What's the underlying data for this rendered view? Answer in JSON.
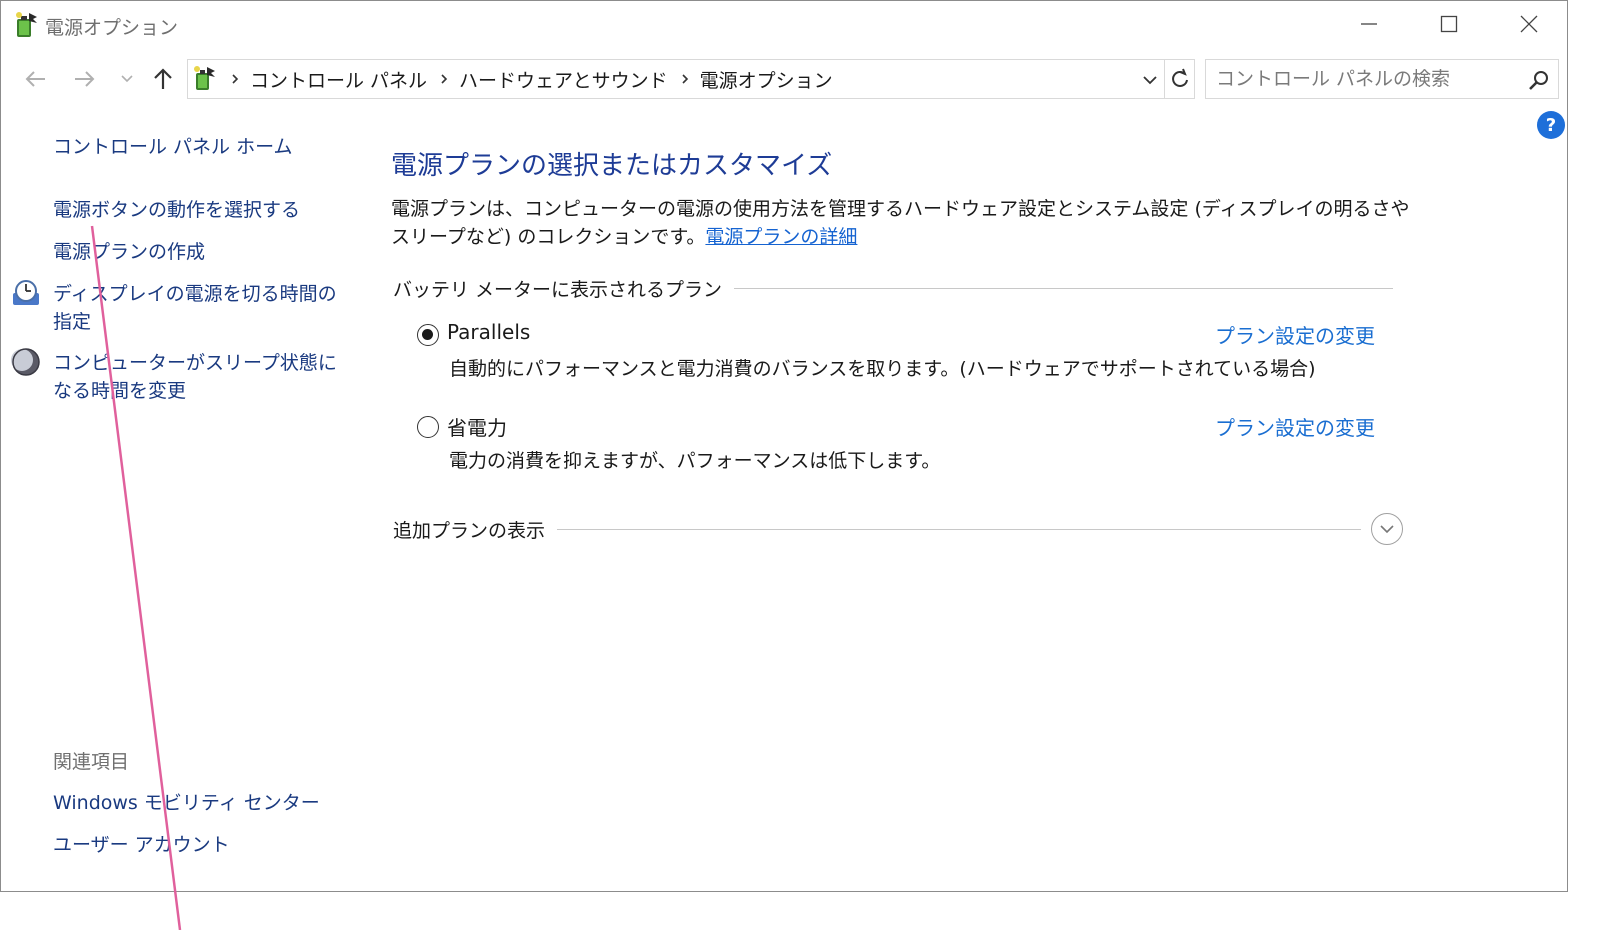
{
  "window": {
    "title": "電源オプション",
    "icon": "power-options-icon"
  },
  "address_bar": {
    "breadcrumbs": [
      "コントロール パネル",
      "ハードウェアとサウンド",
      "電源オプション"
    ]
  },
  "search": {
    "placeholder": "コントロール パネルの検索"
  },
  "help": {
    "label": "?"
  },
  "sidebar": {
    "home": "コントロール パネル ホーム",
    "items": [
      {
        "label": "電源ボタンの動作を選択する"
      },
      {
        "label": "電源プランの作成"
      },
      {
        "label": "ディスプレイの電源を切る時間の指定",
        "icon": "clock-icon"
      },
      {
        "label": "コンピューターがスリープ状態になる時間を変更",
        "icon": "moon-icon"
      }
    ],
    "related_heading": "関連項目",
    "related": [
      {
        "label": "Windows モビリティ センター"
      },
      {
        "label": "ユーザー アカウント"
      }
    ]
  },
  "main": {
    "title": "電源プランの選択またはカスタマイズ",
    "description": "電源プランは、コンピューターの電源の使用方法を管理するハードウェア設定とシステム設定 (ディスプレイの明るさやスリープなど) のコレクションです。",
    "details_link": "電源プランの詳細",
    "group_label": "バッテリ メーターに表示されるプラン",
    "plans": [
      {
        "name": "Parallels",
        "description": "自動的にパフォーマンスと電力消費のバランスを取ります。(ハードウェアでサポートされている場合)",
        "change_link": "プラン設定の変更",
        "selected": true
      },
      {
        "name": "省電力",
        "description": "電力の消費を抑えますが、パフォーマンスは低下します。",
        "change_link": "プラン設定の変更",
        "selected": false
      }
    ],
    "more_plans_label": "追加プランの表示"
  },
  "colors": {
    "accent_link": "#1a6ed1",
    "title_blue": "#1e3c96",
    "annotation_line": "#e0609c"
  }
}
